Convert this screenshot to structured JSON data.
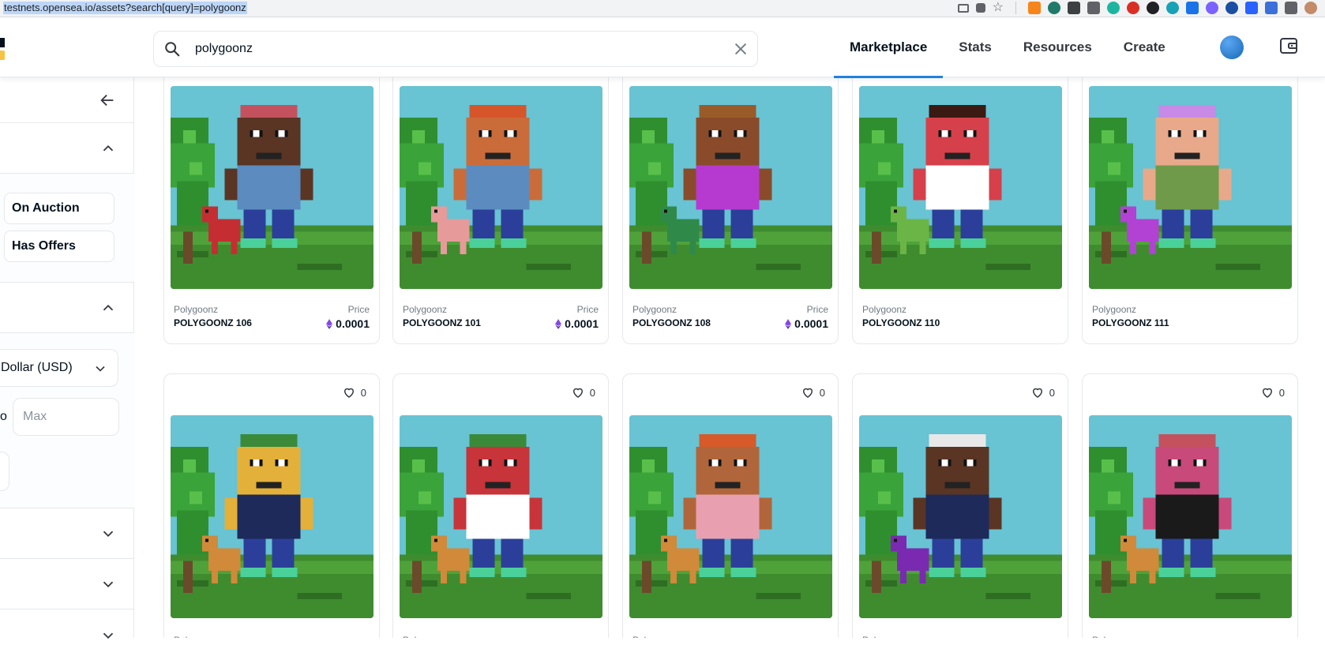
{
  "browser": {
    "url": "testnets.opensea.io/assets?search[query]=polygoonz"
  },
  "header": {
    "search_value": "polygoonz",
    "nav": [
      {
        "label": "Marketplace",
        "active": true
      },
      {
        "label": "Stats",
        "active": false
      },
      {
        "label": "Resources",
        "active": false
      },
      {
        "label": "Create",
        "active": false
      }
    ]
  },
  "sidebar": {
    "status_chips": [
      "On Auction",
      "Has Offers"
    ],
    "currency_label": "Dollar (USD)",
    "to_label": "o",
    "max_placeholder": "Max"
  },
  "cards_row1": [
    {
      "collection": "Polygoonz",
      "name": "POLYGOONZ 106",
      "price_label": "Price",
      "price": "0.0001",
      "hair": "#c4525e",
      "skin": "#5a3524",
      "shirt": "#5b8bbf",
      "pet": "#c42e32"
    },
    {
      "collection": "Polygoonz",
      "name": "POLYGOONZ 101",
      "price_label": "Price",
      "price": "0.0001",
      "hair": "#d6552a",
      "skin": "#c96c3a",
      "shirt": "#5b8bbf",
      "pet": "#e79a9a"
    },
    {
      "collection": "Polygoonz",
      "name": "POLYGOONZ 108",
      "price_label": "Price",
      "price": "0.0001",
      "hair": "#9a5b2a",
      "skin": "#8a4b2a",
      "shirt": "#b63ad0",
      "pet": "#2f8a4a"
    },
    {
      "collection": "Polygoonz",
      "name": "POLYGOONZ 110",
      "price_label": "",
      "price": "",
      "hair": "#3a1a12",
      "skin": "#d6404a",
      "shirt": "#ffffff",
      "pet": "#6bb546"
    },
    {
      "collection": "Polygoonz",
      "name": "POLYGOONZ 111",
      "price_label": "",
      "price": "",
      "hair": "#c78ae6",
      "skin": "#e8a98a",
      "shirt": "#6e9a4a",
      "pet": "#b142d4"
    }
  ],
  "cards_row2": [
    {
      "likes": "0",
      "hair": "#3a8a3a",
      "skin": "#e3b03a",
      "shirt": "#1d2a5a",
      "pet": "#d08a3a"
    },
    {
      "likes": "0",
      "hair": "#3a8a3a",
      "skin": "#c7343a",
      "shirt": "#ffffff",
      "pet": "#d08a3a"
    },
    {
      "likes": "0",
      "hair": "#d65a2a",
      "skin": "#b0663a",
      "shirt": "#e8a0b0",
      "pet": "#d08a3a"
    },
    {
      "likes": "0",
      "hair": "#e8e8e8",
      "skin": "#5a3524",
      "shirt": "#1d2a5a",
      "pet": "#7a2ab0"
    },
    {
      "likes": "0",
      "hair": "#c4525e",
      "skin": "#c84a7a",
      "shirt": "#1a1a1a",
      "pet": "#d08a3a"
    }
  ],
  "row2_footer": [
    "Poly",
    "Poly",
    "Poly",
    "Poly",
    "Poly"
  ]
}
